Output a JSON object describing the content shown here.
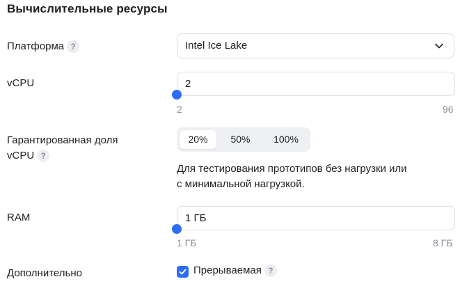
{
  "section": {
    "title": "Вычислительные ресурсы"
  },
  "platform": {
    "label": "Платформа",
    "help_icon": "question-icon",
    "value": "Intel Ice Lake",
    "chevron_icon": "chevron-down-icon"
  },
  "vcpu": {
    "label": "vCPU",
    "value": "2",
    "min_label": "2",
    "max_label": "96",
    "slider_fraction": 0.0
  },
  "core_fraction": {
    "label_line1": "Гарантированная доля",
    "label_line2": "vCPU",
    "help_icon": "question-icon",
    "options": [
      "20%",
      "50%",
      "100%"
    ],
    "selected": "20%",
    "description_line1": "Для тестирования прототипов без нагрузки или",
    "description_line2": "с минимальной нагрузкой."
  },
  "ram": {
    "label": "RAM",
    "value": "1 ГБ",
    "min_label": "1 ГБ",
    "max_label": "8 ГБ",
    "slider_fraction": 0.0
  },
  "additional": {
    "label": "Дополнительно",
    "checkbox_label": "Прерываемая",
    "checked": true,
    "help_icon": "question-icon"
  },
  "colors": {
    "accent": "#2d6df6",
    "border": "#d9dce2",
    "muted_text": "#8a8f99",
    "segment_bg": "#eef0f3"
  }
}
